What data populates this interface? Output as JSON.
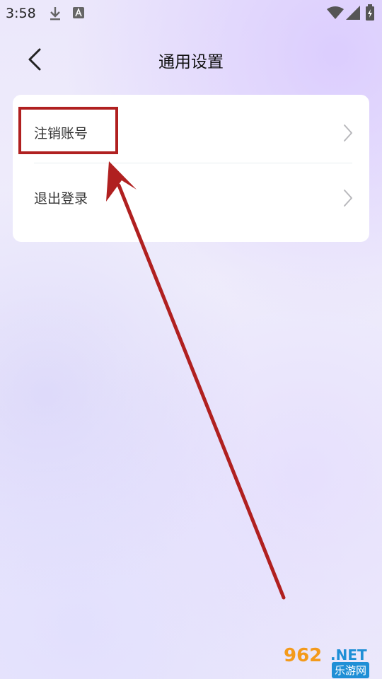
{
  "status_bar": {
    "time": "3:58",
    "icons": [
      "download-icon",
      "text-a-icon",
      "wifi-icon",
      "signal-icon",
      "battery-icon"
    ]
  },
  "header": {
    "title": "通用设置",
    "back_icon": "chevron-left-icon"
  },
  "settings": {
    "items": [
      {
        "label": "注销账号",
        "icon": "chevron-right-icon"
      },
      {
        "label": "退出登录",
        "icon": "chevron-right-icon"
      }
    ]
  },
  "annotation": {
    "highlight_color": "#b02020",
    "arrow_color": "#b02020"
  },
  "watermark": {
    "number": "962",
    "domain": ".NET",
    "cn_text": "乐游网"
  }
}
